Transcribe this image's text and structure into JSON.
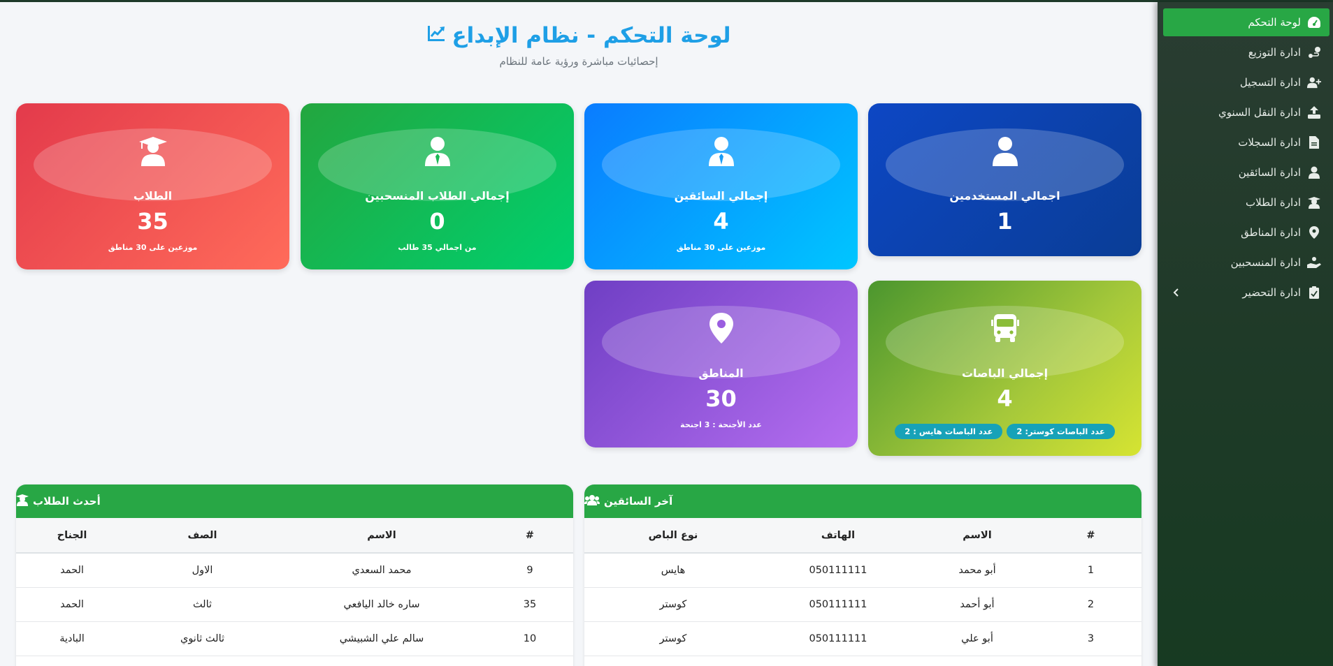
{
  "header": {
    "title": "لوحة التحكم - نظام الإبداع",
    "subtitle": "إحصائيات مباشرة ورؤية عامة للنظام"
  },
  "sidebar": {
    "items": [
      {
        "label": "لوحة التحكم",
        "icon": "dashboard-gauge-icon",
        "active": true
      },
      {
        "label": "ادارة التوزيع",
        "icon": "route-icon"
      },
      {
        "label": "ادارة التسجيل",
        "icon": "user-plus-icon"
      },
      {
        "label": "ادارة النقل السنوي",
        "icon": "upload-icon"
      },
      {
        "label": "ادارة السجلات",
        "icon": "file-icon"
      },
      {
        "label": "ادارة السائقين",
        "icon": "user-icon"
      },
      {
        "label": "ادارة الطلاب",
        "icon": "graduate-icon"
      },
      {
        "label": "ادارة المناطق",
        "icon": "map-marker-icon"
      },
      {
        "label": "ادارة المنسحبين",
        "icon": "hand-holding-icon"
      },
      {
        "label": "ادارة التحضير",
        "icon": "clipboard-check-icon"
      }
    ]
  },
  "cards": {
    "users": {
      "title": "اجمالي المستخدمين",
      "value": "1"
    },
    "drivers": {
      "title": "إجمالي السائقين",
      "value": "4",
      "sub": "موزعين على 30 مناطق"
    },
    "withdrawn": {
      "title": "إجمالي الطلاب المنسحبين",
      "value": "0",
      "sub": "من اجمالي 35 طالب"
    },
    "students": {
      "title": "الطلاب",
      "value": "35",
      "sub": "موزعين على 30 مناطق"
    },
    "buses": {
      "title": "إجمالي الباصات",
      "value": "4",
      "badge1": "عدد الباصات كوستر: 2",
      "badge2": "عدد الباصات هايس : 2"
    },
    "regions": {
      "title": "المناطق",
      "value": "30",
      "sub": "عدد الأجنحة : 3 اجنحة"
    }
  },
  "drivers_panel": {
    "title": "آخر السائقين",
    "columns": [
      "#",
      "الاسم",
      "الهاتف",
      "نوع الباص"
    ],
    "rows": [
      [
        "1",
        "أبو محمد",
        "050111111",
        "هايس"
      ],
      [
        "2",
        "أبو أحمد",
        "050111111",
        "كوستر"
      ],
      [
        "3",
        "أبو علي",
        "050111111",
        "كوستر"
      ]
    ]
  },
  "students_panel": {
    "title": "أحدث الطلاب",
    "columns": [
      "#",
      "الاسم",
      "الصف",
      "الجناح"
    ],
    "rows": [
      [
        "9",
        "محمد السعدي",
        "الاول",
        "الحمد"
      ],
      [
        "35",
        "ساره خالد اليافعي",
        "ثالث",
        "الحمد"
      ],
      [
        "10",
        "سالم علي الشبيشي",
        "ثالث ثانوي",
        "البادية"
      ]
    ]
  },
  "colors": {
    "accent": "#28a745",
    "title": "#1e9fe6",
    "sidebar": "#1f3a28"
  }
}
